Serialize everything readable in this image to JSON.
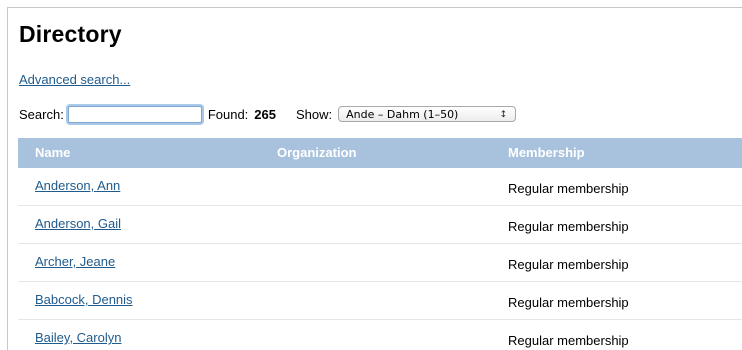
{
  "page": {
    "title": "Directory",
    "advanced_search": "Advanced search..."
  },
  "search": {
    "label": "Search:",
    "value": "",
    "found_label": "Found:",
    "found_count": "265",
    "show_label": "Show:",
    "show_selected": "Ande – Dahm (1–50)"
  },
  "table": {
    "headers": {
      "name": "Name",
      "organization": "Organization",
      "membership": "Membership"
    },
    "rows": [
      {
        "name": "Anderson, Ann",
        "organization": "",
        "membership": "Regular membership"
      },
      {
        "name": "Anderson, Gail",
        "organization": "",
        "membership": "Regular membership"
      },
      {
        "name": "Archer, Jeane",
        "organization": "",
        "membership": "Regular membership"
      },
      {
        "name": "Babcock, Dennis",
        "organization": "",
        "membership": "Regular membership"
      },
      {
        "name": "Bailey, Carolyn",
        "organization": "",
        "membership": "Regular membership"
      }
    ]
  },
  "colors": {
    "header_bg": "#a8c2de",
    "link": "#1f5b8c"
  }
}
